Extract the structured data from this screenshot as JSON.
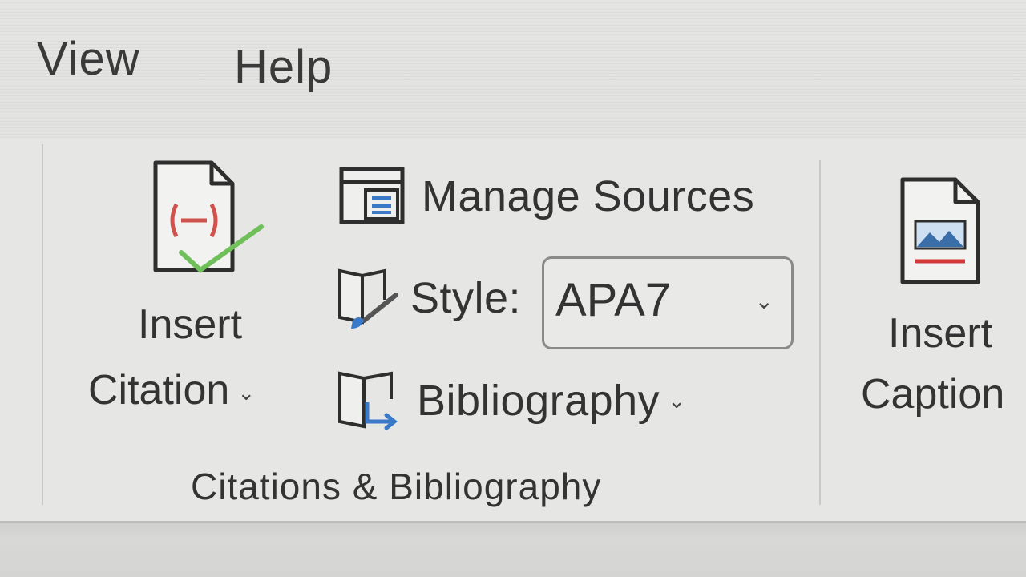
{
  "menu": {
    "tabs": [
      {
        "label": "View"
      },
      {
        "label": "Help"
      }
    ]
  },
  "ribbon": {
    "insert_citation": {
      "line1": "Insert",
      "line2": "Citation",
      "dropdown_icon": "chevron-down-icon",
      "icon": "insert-citation-icon"
    },
    "manage_sources": {
      "label": "Manage Sources",
      "icon": "manage-sources-icon"
    },
    "style": {
      "label": "Style:",
      "icon": "style-brush-icon",
      "selected_value": "APA7"
    },
    "bibliography": {
      "label": "Bibliography",
      "icon": "bibliography-icon",
      "dropdown_icon": "chevron-down-icon"
    },
    "group_label": "Citations & Bibliography",
    "insert_caption": {
      "line1": "Insert",
      "line2": "Caption",
      "icon": "insert-caption-icon"
    }
  },
  "colors": {
    "citation_red": "#d0524d",
    "check_green": "#6fbf5a",
    "accent_blue": "#3a78c8",
    "caption_red": "#d23a3a"
  }
}
